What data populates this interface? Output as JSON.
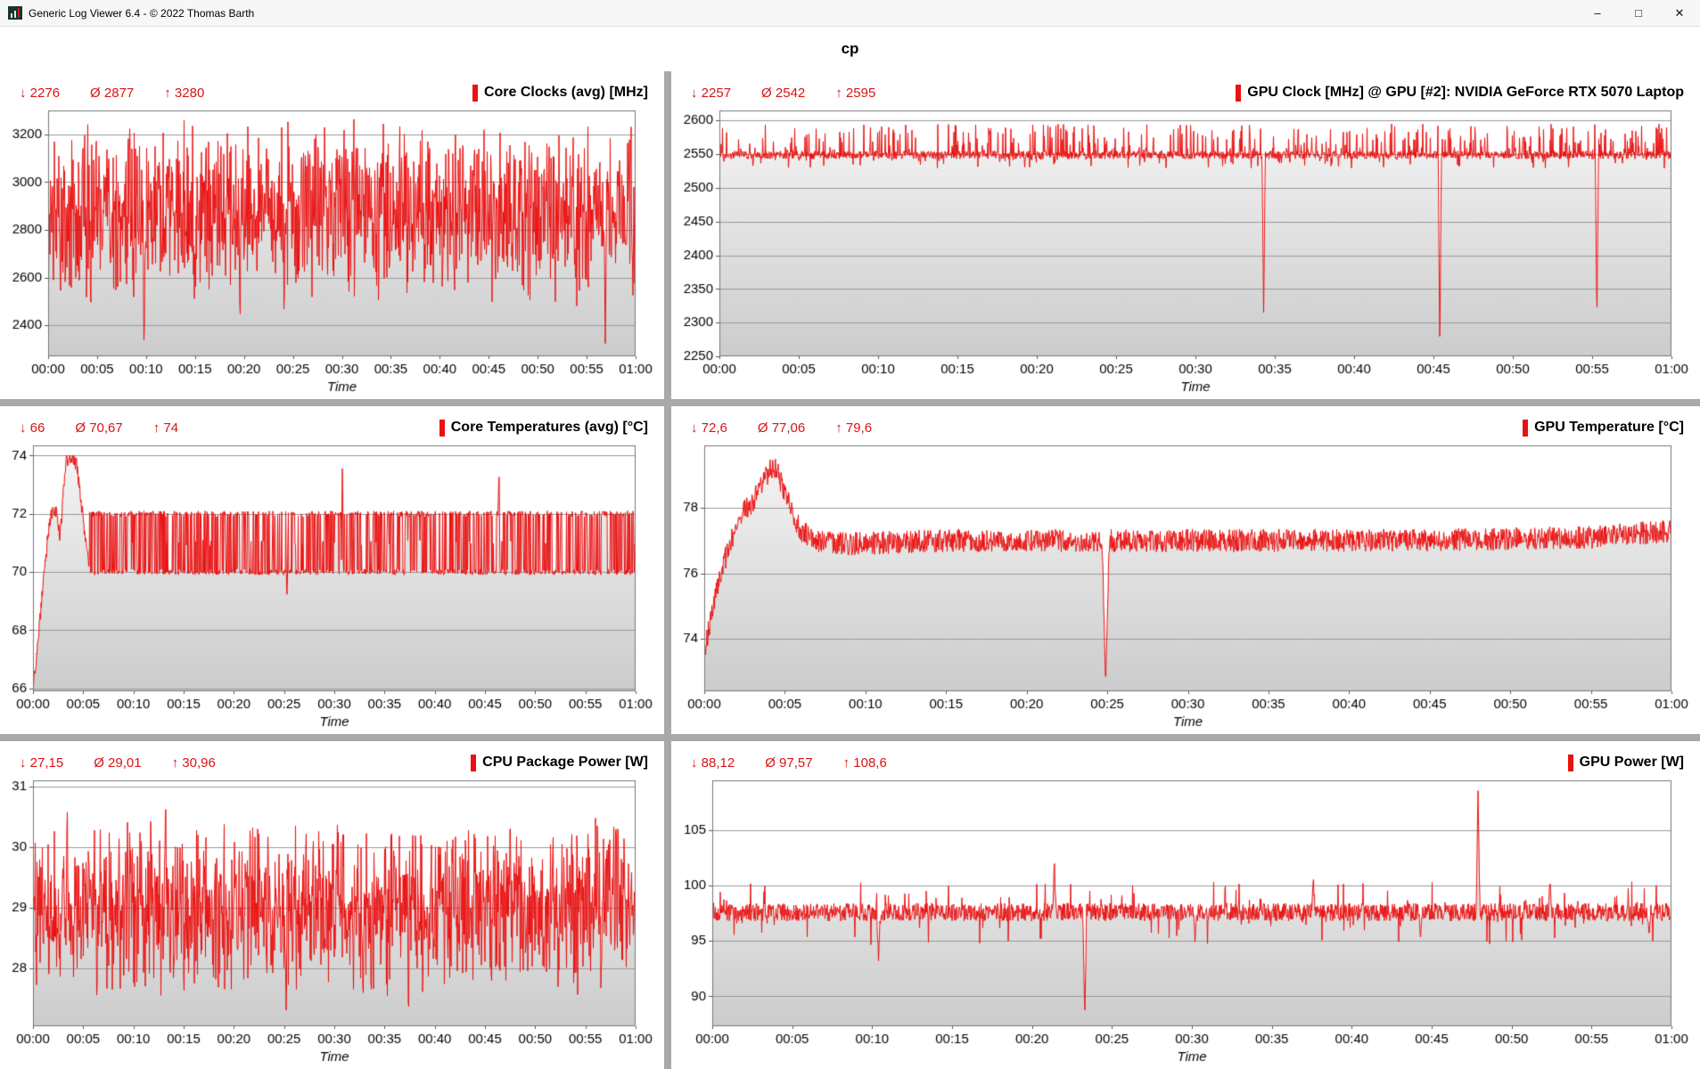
{
  "window": {
    "title": "Generic Log Viewer 6.4 - © 2022 Thomas Barth",
    "controls": {
      "minimize": "–",
      "maximize": "□",
      "close": "✕"
    }
  },
  "header": {
    "title": "cp"
  },
  "theme": {
    "accent": "#d81414",
    "line": "#ea1111",
    "grid": "#999999",
    "plot_border": "#777777",
    "fill_top": "#f6f6f6",
    "fill_bottom": "#cccccc"
  },
  "chart_data": [
    {
      "id": "core-clocks",
      "type": "line",
      "title": "Core Clocks (avg) [MHz]",
      "stats": {
        "min": "↓ 2276",
        "avg": "Ø 2877",
        "max": "↑ 3280"
      },
      "color": "#ea1111",
      "xlabel": "Time",
      "xlim": [
        0,
        60
      ],
      "x_ticks": [
        "00:00",
        "00:05",
        "00:10",
        "00:15",
        "00:20",
        "00:25",
        "00:30",
        "00:35",
        "00:40",
        "00:45",
        "00:50",
        "00:55",
        "01:00"
      ],
      "ylim": [
        2270,
        3300
      ],
      "y_ticks": [
        2400,
        2600,
        2800,
        3000,
        3200
      ],
      "grid": "horizontal",
      "legend_position": "top-right",
      "trend": [
        [
          0,
          2875
        ],
        [
          60,
          2875
        ]
      ],
      "noise": {
        "type": "triangular",
        "amp": 400,
        "clip": [
          2400,
          3280
        ],
        "density": 2
      },
      "events": [
        [
          9.8,
          2276,
          0.12
        ],
        [
          19.6,
          2350,
          0.12
        ],
        [
          24.1,
          2380,
          0.1
        ],
        [
          56.9,
          2300,
          0.12
        ]
      ]
    },
    {
      "id": "gpu-clock",
      "type": "line",
      "title": "GPU Clock [MHz] @ GPU [#2]: NVIDIA GeForce RTX 5070 Laptop",
      "stats": {
        "min": "↓ 2257",
        "avg": "Ø 2542",
        "max": "↑ 2595"
      },
      "color": "#ea1111",
      "xlabel": "Time",
      "xlim": [
        0,
        60
      ],
      "x_ticks": [
        "00:00",
        "00:05",
        "00:10",
        "00:15",
        "00:20",
        "00:25",
        "00:30",
        "00:35",
        "00:40",
        "00:45",
        "00:50",
        "00:55",
        "01:00"
      ],
      "ylim": [
        2250,
        2615
      ],
      "y_ticks": [
        2250,
        2300,
        2350,
        2400,
        2450,
        2500,
        2550,
        2600
      ],
      "grid": "horizontal",
      "legend_position": "top-right",
      "trend": [
        [
          0,
          2549
        ],
        [
          60,
          2549
        ]
      ],
      "noise": {
        "type": "spiky",
        "small": 6,
        "p_up": 0.2,
        "up": 46,
        "p_dn": 0.05,
        "dn": 20,
        "clip": [
          2250,
          2595
        ],
        "density": 2
      },
      "events": [
        [
          34.3,
          2310,
          0.1
        ],
        [
          45.4,
          2257,
          0.1
        ],
        [
          55.3,
          2300,
          0.1
        ]
      ]
    },
    {
      "id": "core-temps",
      "type": "line",
      "title": "Core Temperatures (avg) [°C]",
      "stats": {
        "min": "↓ 66",
        "avg": "Ø 70,67",
        "max": "↑ 74"
      },
      "color": "#ea1111",
      "xlabel": "Time",
      "xlim": [
        0,
        60
      ],
      "x_ticks": [
        "00:00",
        "00:05",
        "00:10",
        "00:15",
        "00:20",
        "00:25",
        "00:30",
        "00:35",
        "00:40",
        "00:45",
        "00:50",
        "00:55",
        "01:00"
      ],
      "ylim": [
        65.9,
        74.35
      ],
      "y_ticks": [
        66,
        68,
        70,
        72,
        74
      ],
      "grid": "horizontal",
      "legend_position": "top-right",
      "trend": [
        [
          0,
          66
        ],
        [
          0.3,
          66.8
        ],
        [
          0.6,
          68
        ],
        [
          0.9,
          69.2
        ],
        [
          1.2,
          70.3
        ],
        [
          1.5,
          71.3
        ],
        [
          1.8,
          72
        ],
        [
          2.4,
          72
        ],
        [
          2.7,
          71.2
        ],
        [
          3.0,
          72.6
        ],
        [
          3.3,
          73.8
        ],
        [
          3.9,
          74
        ],
        [
          4.4,
          73.6
        ],
        [
          4.8,
          72.4
        ],
        [
          5.2,
          71.2
        ],
        [
          5.6,
          70.2
        ],
        [
          60,
          70
        ]
      ],
      "noise": {
        "type": "toggle",
        "after": 5.6,
        "low": 70,
        "high": 72,
        "mid": 71,
        "p_switch": 0.38,
        "p_mid": 0.05,
        "jitter": 0.1,
        "clip": [
          66,
          74
        ],
        "density": 2
      },
      "events": [
        [
          25.3,
          69.2,
          0.12
        ],
        [
          30.8,
          73.6,
          0.1
        ],
        [
          46.4,
          73.6,
          0.1
        ]
      ]
    },
    {
      "id": "gpu-temp",
      "type": "line",
      "title": "GPU Temperature [°C]",
      "stats": {
        "min": "↓ 72,6",
        "avg": "Ø 77,06",
        "max": "↑ 79,6"
      },
      "color": "#ea1111",
      "xlabel": "Time",
      "xlim": [
        0,
        60
      ],
      "x_ticks": [
        "00:00",
        "00:05",
        "00:10",
        "00:15",
        "00:20",
        "00:25",
        "00:30",
        "00:35",
        "00:40",
        "00:45",
        "00:50",
        "00:55",
        "01:00"
      ],
      "ylim": [
        72.4,
        79.9
      ],
      "y_ticks": [
        74,
        76,
        78
      ],
      "grid": "horizontal",
      "legend_position": "top-right",
      "trend": [
        [
          0,
          73.6
        ],
        [
          0.4,
          74.6
        ],
        [
          0.8,
          75.6
        ],
        [
          1.2,
          76.3
        ],
        [
          1.6,
          76.9
        ],
        [
          2.0,
          77.4
        ],
        [
          2.5,
          77.9
        ],
        [
          3.0,
          78.2
        ],
        [
          3.5,
          78.6
        ],
        [
          4.0,
          79.1
        ],
        [
          4.3,
          79.3
        ],
        [
          4.6,
          79.0
        ],
        [
          5.0,
          78.5
        ],
        [
          5.5,
          77.8
        ],
        [
          6.0,
          77.3
        ],
        [
          7.0,
          77.0
        ],
        [
          9.0,
          76.9
        ],
        [
          15,
          77.0
        ],
        [
          25,
          77.0
        ],
        [
          35,
          77.0
        ],
        [
          45,
          77.0
        ],
        [
          55,
          77.1
        ],
        [
          60,
          77.3
        ]
      ],
      "noise": {
        "type": "uniform",
        "amp": 0.35,
        "clip": [
          72.6,
          79.6
        ],
        "density": 2
      },
      "events": [
        [
          24.9,
          72.6,
          0.22
        ]
      ]
    },
    {
      "id": "cpu-power",
      "type": "line",
      "title": "CPU Package Power [W]",
      "stats": {
        "min": "↓ 27,15",
        "avg": "Ø 29,01",
        "max": "↑ 30,96"
      },
      "color": "#ea1111",
      "xlabel": "Time",
      "xlim": [
        0,
        60
      ],
      "x_ticks": [
        "00:00",
        "00:05",
        "00:10",
        "00:15",
        "00:20",
        "00:25",
        "00:30",
        "00:35",
        "00:40",
        "00:45",
        "00:50",
        "00:55",
        "01:00"
      ],
      "ylim": [
        27.05,
        31.1
      ],
      "y_ticks": [
        28,
        29,
        30,
        31
      ],
      "grid": "horizontal",
      "legend_position": "top-right",
      "trend": [
        [
          0,
          29.0
        ],
        [
          60,
          29.0
        ]
      ],
      "noise": {
        "type": "triangular",
        "amp": 1.5,
        "clip": [
          27.4,
          30.6
        ],
        "density": 2
      },
      "events": [
        [
          3.4,
          30.7,
          0.1
        ],
        [
          13.2,
          30.96,
          0.1
        ],
        [
          21.6,
          30.6,
          0.1
        ],
        [
          25.2,
          27.2,
          0.1
        ],
        [
          30.3,
          30.6,
          0.1
        ],
        [
          37.4,
          27.15,
          0.1
        ],
        [
          47.5,
          30.5,
          0.1
        ],
        [
          56.2,
          30.6,
          0.1
        ]
      ]
    },
    {
      "id": "gpu-power",
      "type": "line",
      "title": "GPU Power [W]",
      "stats": {
        "min": "↓ 88,12",
        "avg": "Ø 97,57",
        "max": "↑ 108,6"
      },
      "color": "#ea1111",
      "xlabel": "Time",
      "xlim": [
        0,
        60
      ],
      "x_ticks": [
        "00:00",
        "00:05",
        "00:10",
        "00:15",
        "00:20",
        "00:25",
        "00:30",
        "00:35",
        "00:40",
        "00:45",
        "00:50",
        "00:55",
        "01:00"
      ],
      "ylim": [
        87.3,
        109.5
      ],
      "y_ticks": [
        90,
        95,
        100,
        105
      ],
      "grid": "horizontal",
      "legend_position": "top-right",
      "trend": [
        [
          0,
          97.6
        ],
        [
          60,
          97.6
        ]
      ],
      "noise": {
        "type": "spiky",
        "small": 0.8,
        "p_up": 0.04,
        "up": 2.8,
        "p_dn": 0.04,
        "dn": 3.0,
        "clip": [
          88.1,
          108.6
        ],
        "density": 2
      },
      "events": [
        [
          10.4,
          93.2,
          0.12
        ],
        [
          21.4,
          102.6,
          0.1
        ],
        [
          23.3,
          88.12,
          0.12
        ],
        [
          30.2,
          94.8,
          0.1
        ],
        [
          37.6,
          101.0,
          0.1
        ],
        [
          44.3,
          95.3,
          0.1
        ],
        [
          47.9,
          108.6,
          0.12
        ],
        [
          52.4,
          100.5,
          0.1
        ],
        [
          58.6,
          95.6,
          0.1
        ]
      ]
    }
  ]
}
